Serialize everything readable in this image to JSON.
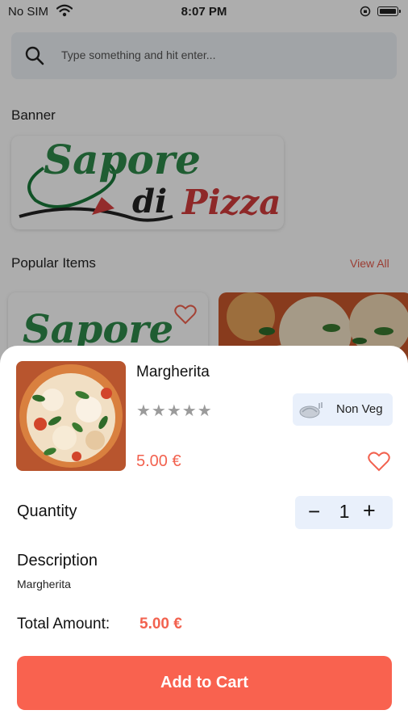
{
  "status_bar": {
    "carrier": "No SIM",
    "time": "8:07 PM"
  },
  "search": {
    "placeholder": "Type something and hit enter..."
  },
  "sections": {
    "banner_title": "Banner",
    "popular_title": "Popular Items",
    "view_all": "View All"
  },
  "banner": {
    "logo_line1": "Sapore",
    "logo_di": "di",
    "logo_pizza": "Pizza"
  },
  "popular_items": [
    {
      "image": "sapore-logo",
      "favorite": false
    },
    {
      "image": "pizza-photo"
    }
  ],
  "product": {
    "name": "Margherita",
    "rating": 0,
    "rating_max": 5,
    "stars": "★★★★★",
    "tag": "Non Veg",
    "price": "5.00 €",
    "favorite": false,
    "quantity_label": "Quantity",
    "quantity": "1",
    "description_title": "Description",
    "description": "Margherita",
    "total_label": "Total Amount:",
    "total_value": "5.00 €",
    "cta": "Add to Cart"
  },
  "colors": {
    "accent": "#f9624f",
    "price": "#f2624f",
    "chip_bg": "#e9f0fb",
    "search_bg": "#eef2f7"
  },
  "icons": {
    "search": "search-icon",
    "heart": "heart-icon",
    "wifi": "wifi-icon",
    "battery": "battery-icon",
    "orientation_lock": "orientation-lock-icon",
    "non_veg": "non-veg-icon"
  }
}
